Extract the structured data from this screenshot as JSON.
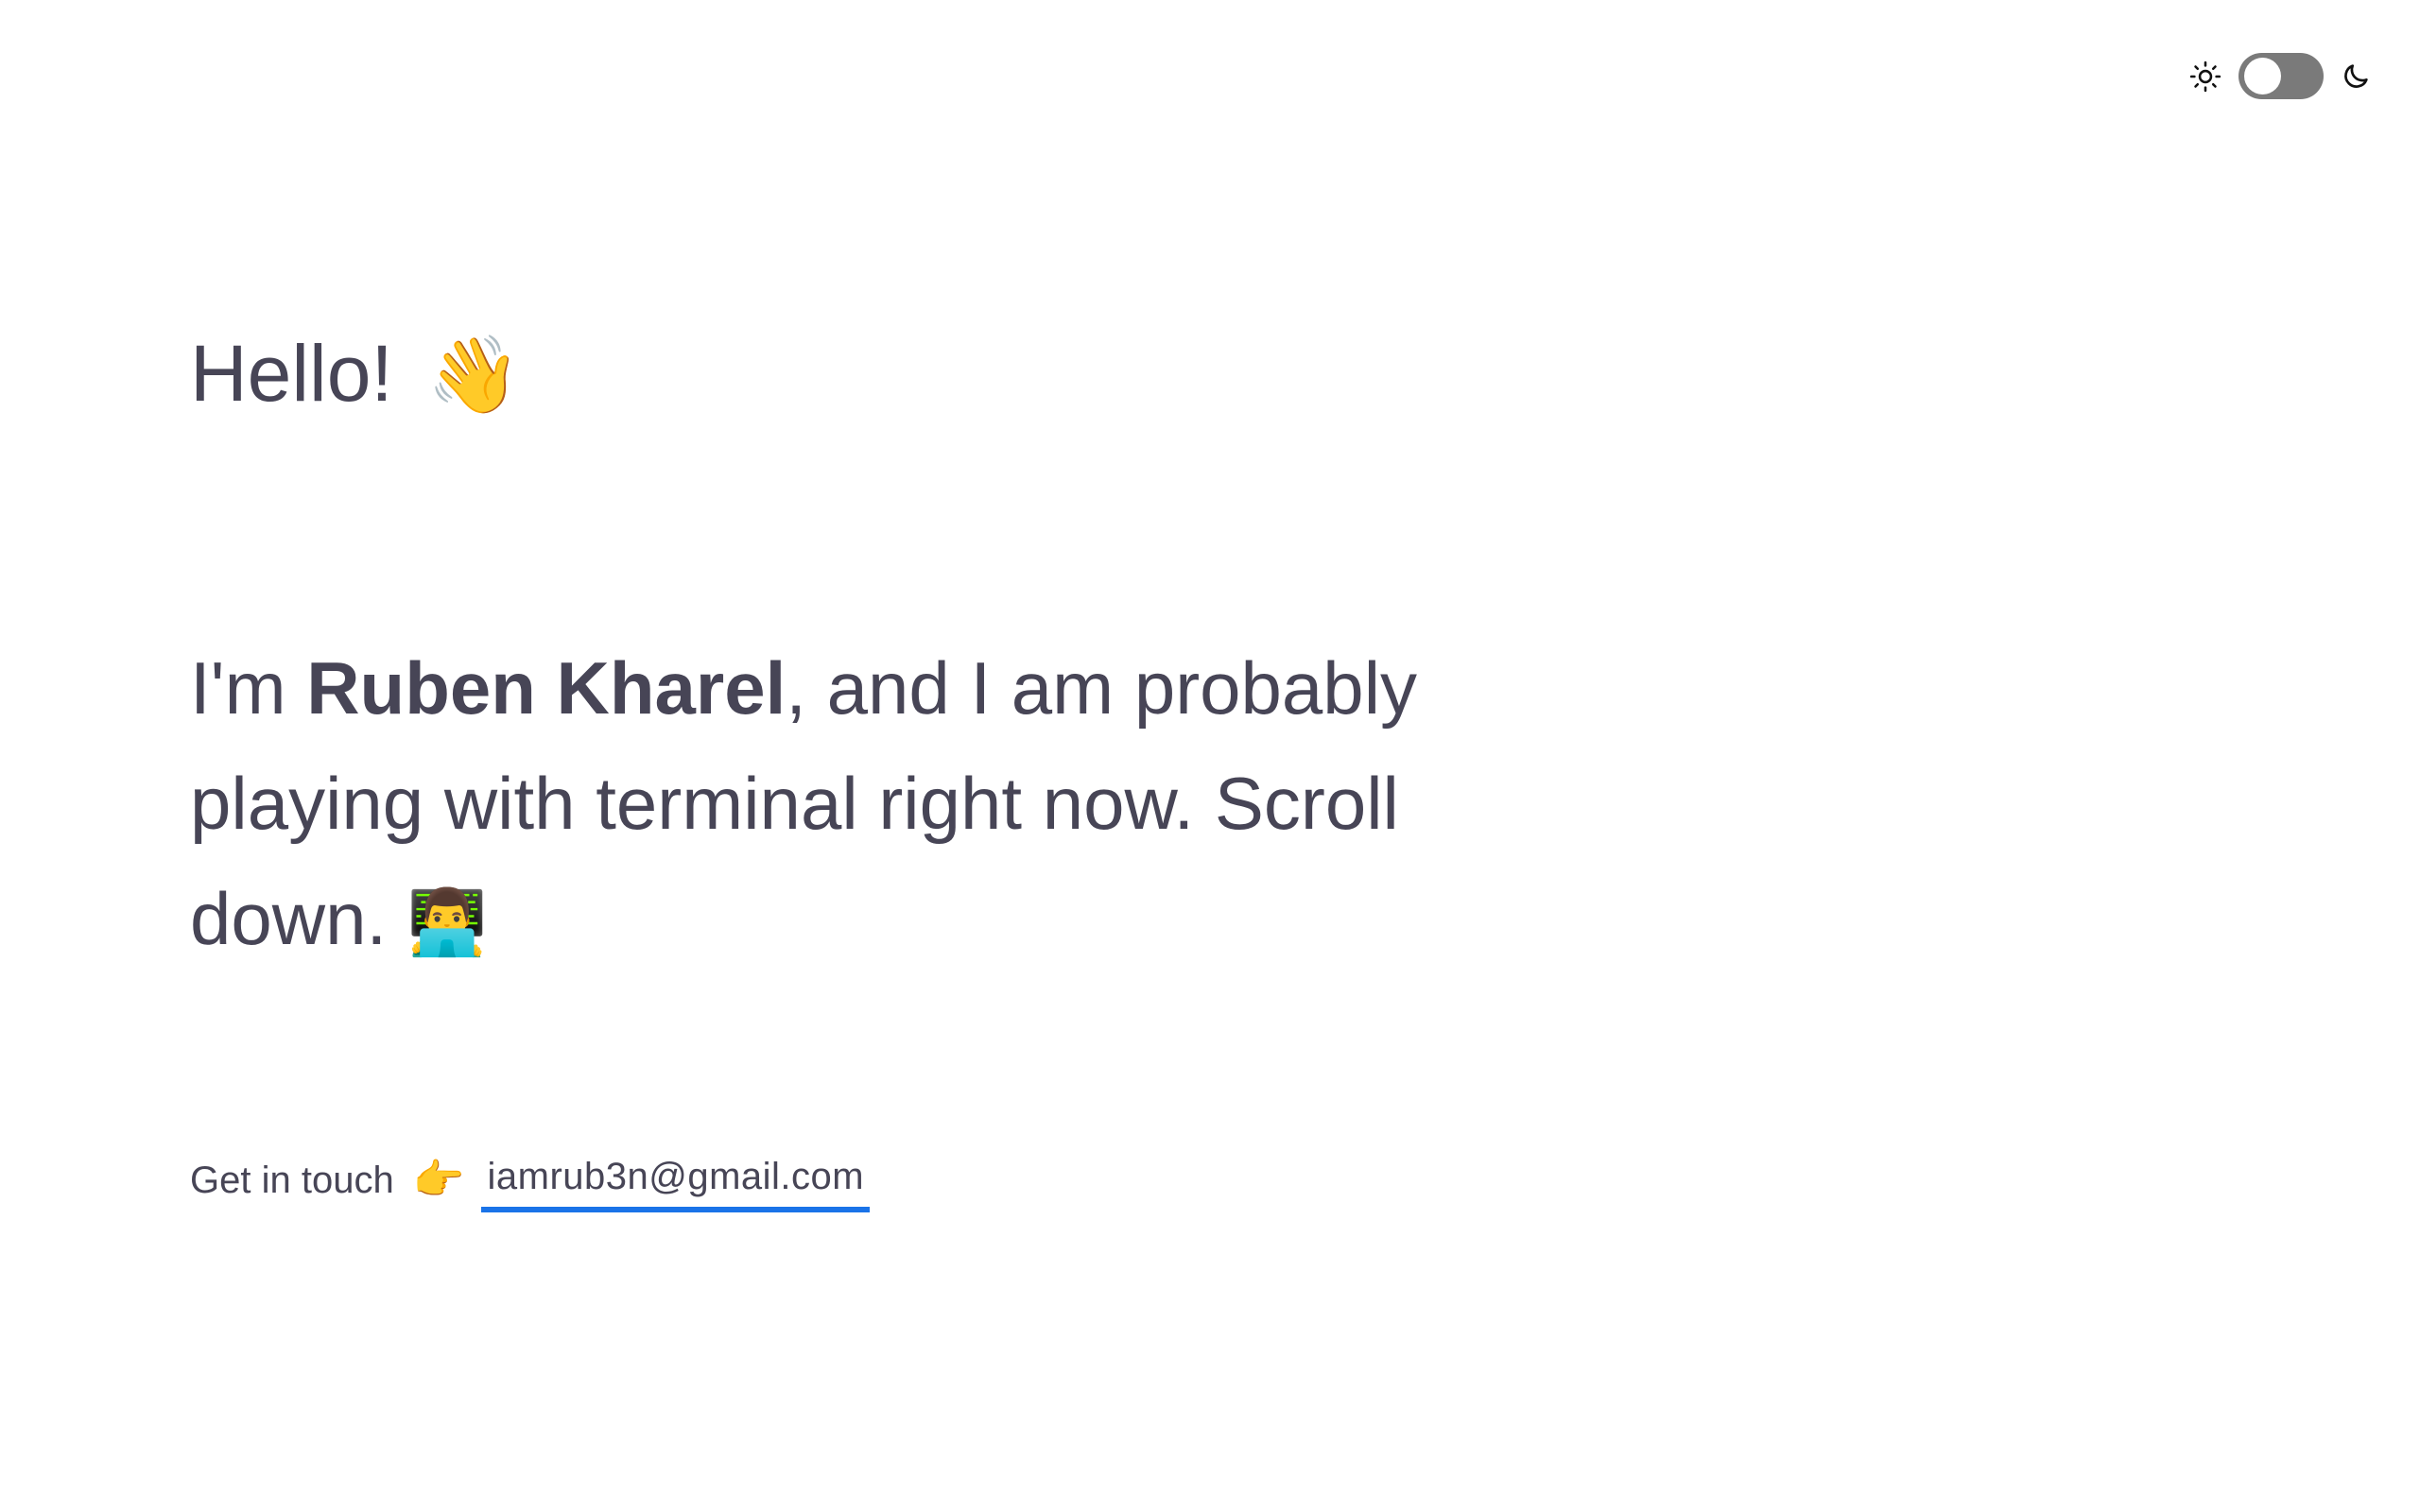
{
  "theme_toggle": {
    "light_icon": "sun-icon",
    "dark_icon": "moon-icon",
    "state": "light",
    "track_color": "#7a7a7a"
  },
  "greeting": {
    "text": "Hello!",
    "emoji": "👋"
  },
  "intro": {
    "prefix": "I'm ",
    "name": "Ruben Kharel",
    "suffix": ", and I am probably playing with terminal right now. Scroll down.",
    "emoji": "👨‍💻"
  },
  "contact": {
    "label": "Get in touch",
    "emoji": "👉",
    "email": "iamrub3n@gmail.com",
    "underline_color": "#1a73e8"
  },
  "colors": {
    "text": "#474556",
    "background": "#ffffff"
  }
}
